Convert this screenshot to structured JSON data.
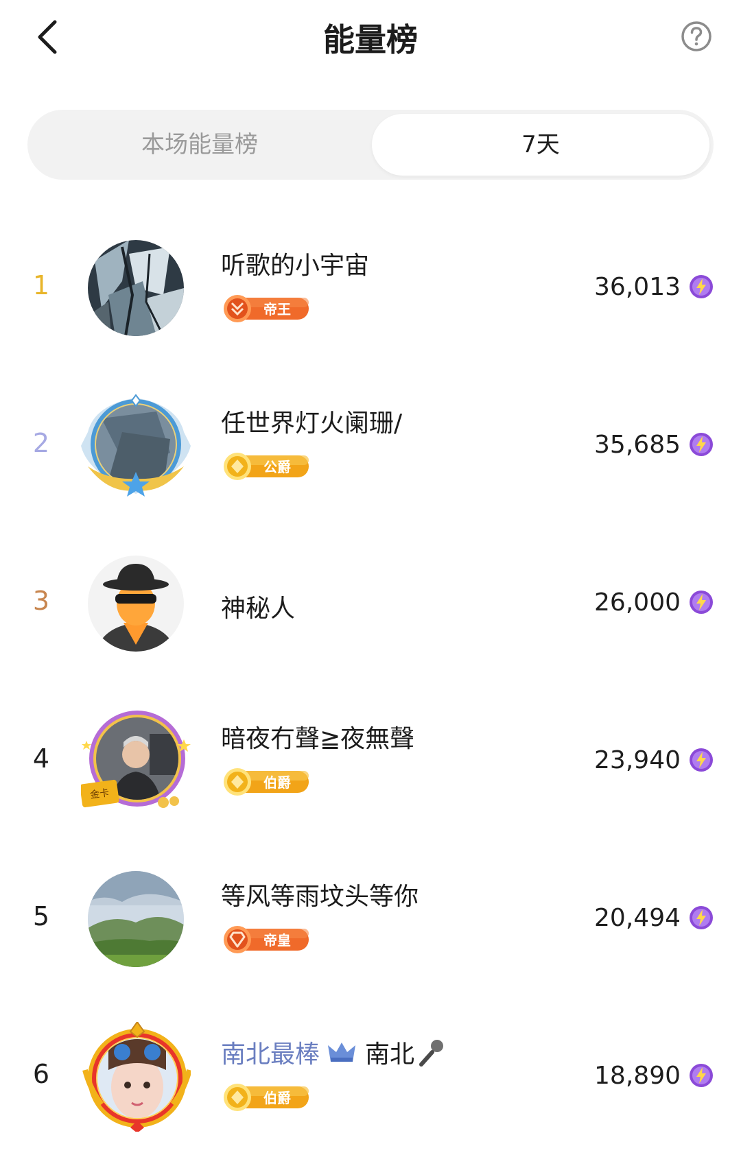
{
  "header": {
    "title": "能量榜"
  },
  "tabs": [
    {
      "label": "本场能量榜",
      "active": false
    },
    {
      "label": "7天",
      "active": true
    }
  ],
  "rows": [
    {
      "rank": "1",
      "rank_color": "#e8b52a",
      "name": "听歌的小宇宙",
      "badge": "帝王",
      "score": "36,013"
    },
    {
      "rank": "2",
      "rank_color": "#a6a9e3",
      "name": "任世界灯火阑珊/",
      "badge": "公爵",
      "score": "35,685"
    },
    {
      "rank": "3",
      "rank_color": "#c8864f",
      "name": "神秘人",
      "score": "26,000"
    },
    {
      "rank": "4",
      "rank_color": "#1e1e1e",
      "name": "暗夜冇聲≧夜無聲",
      "badge": "伯爵",
      "avatar_frame_text": "金卡",
      "score": "23,940"
    },
    {
      "rank": "5",
      "rank_color": "#1e1e1e",
      "name": "等风等雨坟头等你",
      "badge": "帝皇",
      "score": "20,494"
    },
    {
      "rank": "6",
      "rank_color": "#1e1e1e",
      "name_prefix": "南北最棒",
      "name": "南北",
      "badge": "伯爵",
      "score": "18,890"
    }
  ],
  "colors": {
    "accent_purple": "#8b4ad8",
    "badge_orange": "#f06a2a",
    "badge_gold": "#f2b21a",
    "vip_blue": "#6a7ec0"
  },
  "icons": {
    "back": "chevron-left-icon",
    "help": "question-circle-icon",
    "score": "lightning-icon",
    "crown": "crown-icon",
    "mic": "microphone-icon"
  }
}
